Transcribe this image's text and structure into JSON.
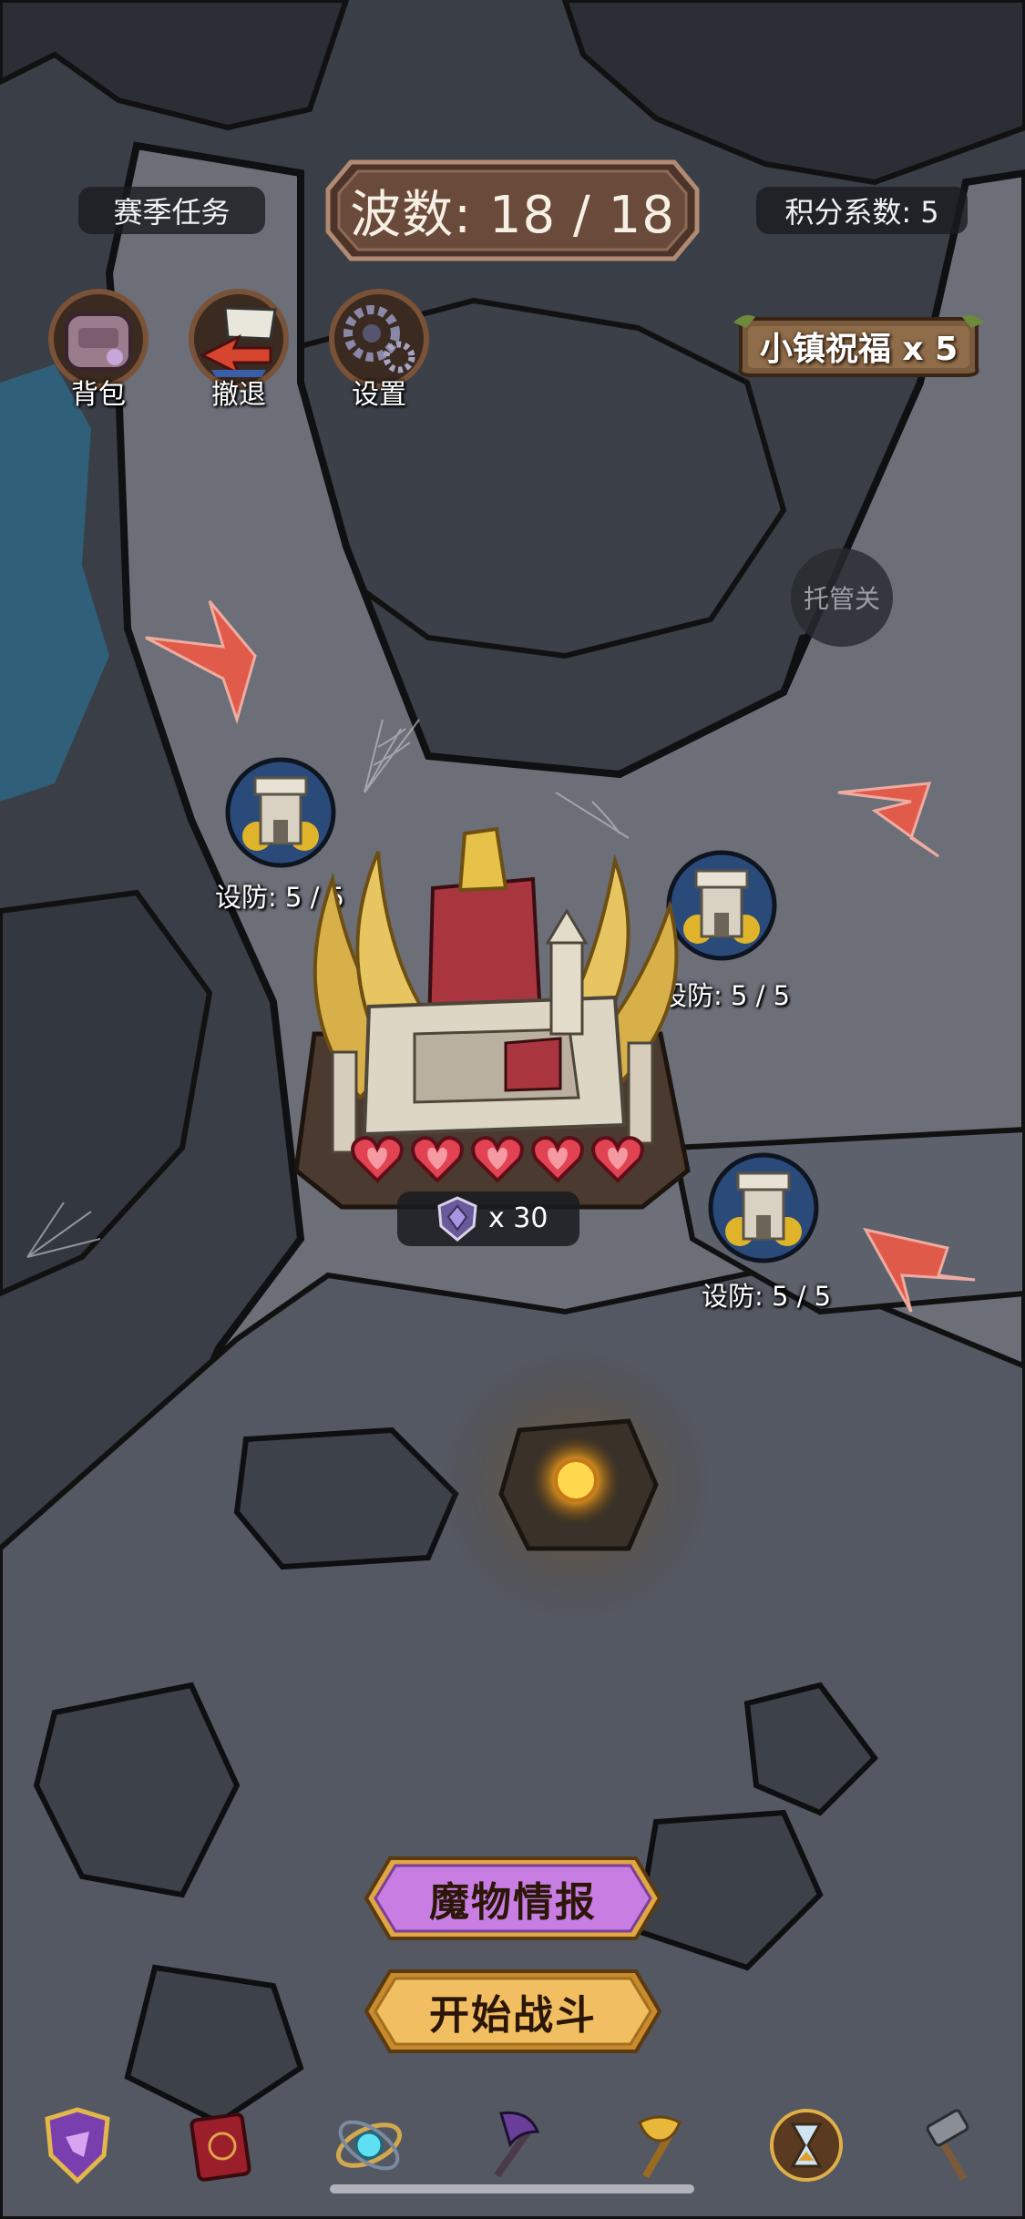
{
  "header": {
    "season_tasks": "赛季任务",
    "wave_label": "波数: 18 / 18",
    "score_factor": "积分系数: 5"
  },
  "menu": {
    "bag": "背包",
    "retreat": "撤退",
    "settings": "设置"
  },
  "blessing": {
    "label": "小镇祝福 x 5"
  },
  "auto_button": {
    "label": "托管关"
  },
  "towers": [
    {
      "label": "设防: 5 / 5"
    },
    {
      "label": "设防: 5 / 5"
    },
    {
      "label": "设防: 5 / 5"
    }
  ],
  "castle": {
    "hearts": 5,
    "gem_count": "x 30"
  },
  "buttons": {
    "monster_info": "魔物情报",
    "start_battle": "开始战斗"
  },
  "toolbar": {
    "icons": [
      "shield-crest-icon",
      "spellbook-icon",
      "orb-armillary-icon",
      "axe-icon",
      "golden-axe-icon",
      "hourglass-icon",
      "hammer-icon"
    ]
  },
  "colors": {
    "wave_frame": "#6a4a3a",
    "button_purple": "#c77de2",
    "button_gold": "#f1bf62",
    "arrow_red": "#e85a48",
    "heart_red": "#e24352"
  }
}
